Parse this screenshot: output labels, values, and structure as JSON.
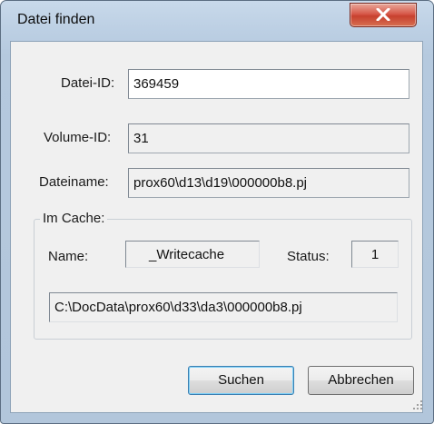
{
  "window": {
    "title": "Datei finden",
    "close_icon": "close-x-icon"
  },
  "fields": {
    "datei_id_label": "Datei-ID:",
    "datei_id_value": "369459",
    "volume_id_label": "Volume-ID:",
    "volume_id_value": "31",
    "dateiname_label": "Dateiname:",
    "dateiname_value": "prox60\\d13\\d19\\000000b8.pj"
  },
  "cache": {
    "group_label": "Im Cache:",
    "name_label": "Name:",
    "name_value": "_Writecache",
    "status_label": "Status:",
    "status_value": "1",
    "path_value": "C:\\DocData\\prox60\\d33\\da3\\000000b8.pj"
  },
  "buttons": {
    "search_label": "Suchen",
    "cancel_label": "Abbrechen"
  },
  "colors": {
    "titlebar": "#bdd0e4",
    "close_button": "#c7412f",
    "dialog_bg": "#f0f0f0"
  }
}
